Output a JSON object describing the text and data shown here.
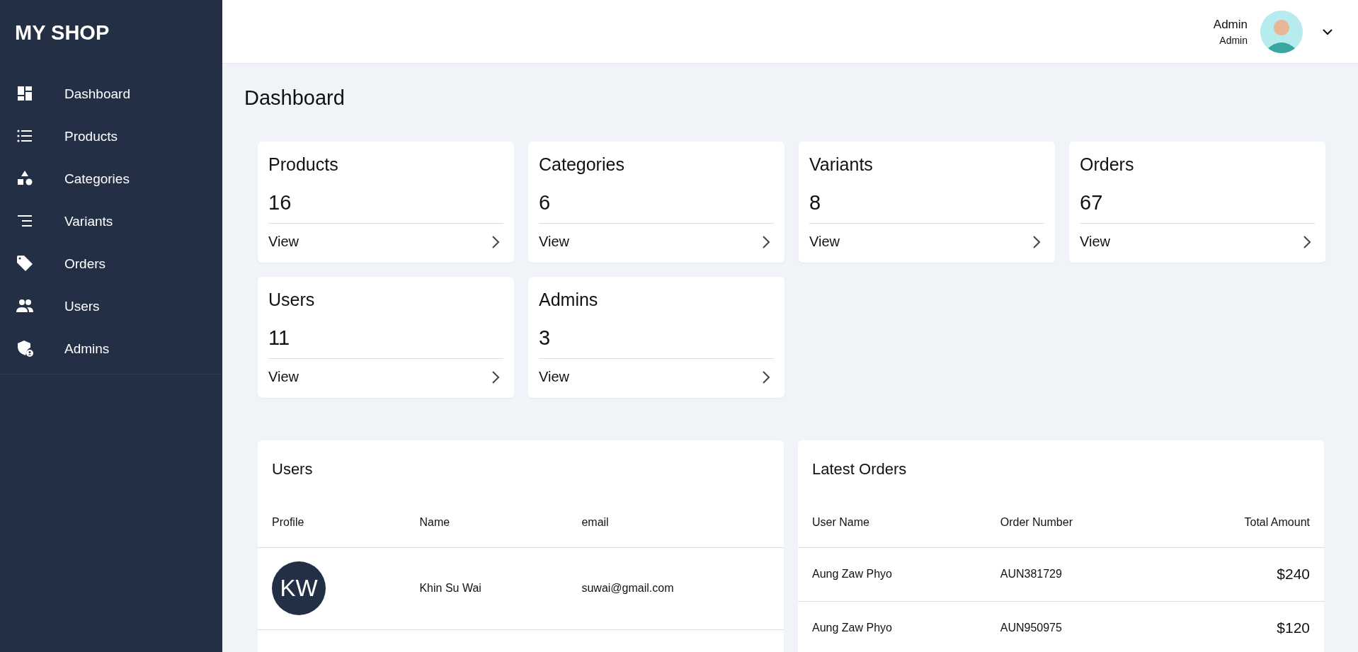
{
  "sidebar": {
    "logo": "MY SHOP",
    "items": [
      {
        "label": "Dashboard"
      },
      {
        "label": "Products"
      },
      {
        "label": "Categories"
      },
      {
        "label": "Variants"
      },
      {
        "label": "Orders"
      },
      {
        "label": "Users"
      },
      {
        "label": "Admins"
      }
    ]
  },
  "header": {
    "user_name": "Admin",
    "user_role": "Admin"
  },
  "page_title": "Dashboard",
  "stats": [
    {
      "label": "Products",
      "count": "16",
      "link": "View"
    },
    {
      "label": "Categories",
      "count": "6",
      "link": "View"
    },
    {
      "label": "Variants",
      "count": "8",
      "link": "View"
    },
    {
      "label": "Orders",
      "count": "67",
      "link": "View"
    },
    {
      "label": "Users",
      "count": "11",
      "link": "View"
    },
    {
      "label": "Admins",
      "count": "3",
      "link": "View"
    }
  ],
  "users_panel": {
    "title": "Users",
    "columns": [
      "Profile",
      "Name",
      "email"
    ],
    "rows": [
      {
        "initials": "KW",
        "name": "Khin Su Wai",
        "email": "suwai@gmail.com"
      }
    ]
  },
  "orders_panel": {
    "title": "Latest Orders",
    "columns": [
      "User Name",
      "Order Number",
      "Total Amount"
    ],
    "rows": [
      {
        "user_name": "Aung Zaw Phyo",
        "order_number": "AUN381729",
        "total": "$240"
      },
      {
        "user_name": "Aung Zaw Phyo",
        "order_number": "AUN950975",
        "total": "$120"
      }
    ]
  }
}
